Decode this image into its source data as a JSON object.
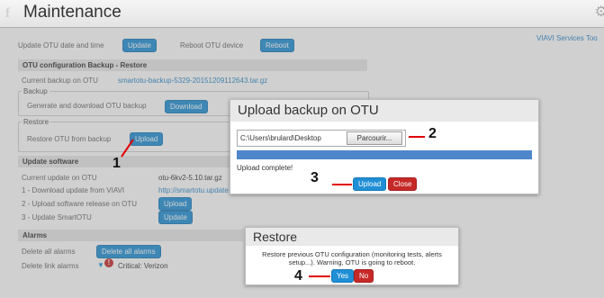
{
  "app": {
    "title": "Maintenance",
    "services_link": "VIAVI Services Too"
  },
  "top": {
    "update_date_label": "Update OTU date and time",
    "update_btn": "Update",
    "reboot_label": "Reboot OTU device",
    "reboot_btn": "Reboot"
  },
  "config": {
    "header": "OTU configuration Backup - Restore",
    "current_backup_label": "Current backup on OTU",
    "current_backup_value": "smartotu-backup-5329-20151209112643.tar.gz",
    "backup_legend": "Backup",
    "generate_label": "Generate and download OTU backup",
    "download_btn": "Download",
    "restore_legend": "Restore",
    "restore_label": "Restore OTU from backup",
    "upload_btn": "Upload"
  },
  "software": {
    "header": "Update software",
    "current_label": "Current update on OTU",
    "current_value": "otu-6kv2-5.10.tar.gz",
    "step1_label": "1 - Download update from VIAVI",
    "step1_link": "http://smartotu.update",
    "step2_label": "2 - Upload software release on OTU",
    "step2_btn": "Upload",
    "step3_label": "3 - Update SmartOTU",
    "step3_btn": "Update"
  },
  "alarms": {
    "header": "Alarms",
    "delete_all_label": "Delete all alarms",
    "delete_all_btn": "Delete all alarms",
    "delete_link_label": "Delete link alarms",
    "critical_text": "Critical:  Verizon"
  },
  "upload_dialog": {
    "title": "Upload backup on OTU",
    "file_path": "C:\\Users\\brulard\\Desktop",
    "browse_btn": "Parcourir...",
    "progress": 1.0,
    "status": "Upload complete!",
    "upload_btn": "Upload",
    "close_btn": "Close"
  },
  "restore_dialog": {
    "title": "Restore",
    "message_line1": "Restore previous OTU configuration (monitoring tests, alerts",
    "message_line2": "setup...). Warning, OTU is going to reboot.",
    "yes_btn": "Yes",
    "no_btn": "No"
  },
  "callouts": [
    "1",
    "2",
    "3",
    "4"
  ],
  "colors": {
    "accent": "#1f8fd6",
    "danger": "#c62828",
    "callout_line": "#e00000"
  }
}
